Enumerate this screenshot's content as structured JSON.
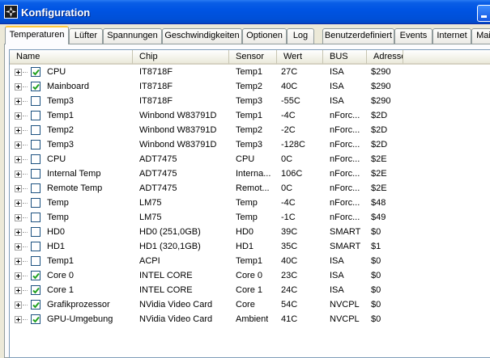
{
  "window": {
    "title": "Konfiguration"
  },
  "tabs": [
    {
      "label": "Temperaturen",
      "active": true
    },
    {
      "label": "Lüfter"
    },
    {
      "label": "Spannungen"
    },
    {
      "label": "Geschwindigkeiten"
    },
    {
      "label": "Optionen"
    },
    {
      "label": "Log"
    },
    {
      "label": "Benutzerdefiniert"
    },
    {
      "label": "Events"
    },
    {
      "label": "Internet"
    },
    {
      "label": "Mai"
    }
  ],
  "columns": [
    "Name",
    "Chip",
    "Sensor",
    "Wert",
    "BUS",
    "Adresse"
  ],
  "rows": [
    {
      "checked": true,
      "name": "CPU",
      "chip": "IT8718F",
      "sensor": "Temp1",
      "wert": "27C",
      "bus": "ISA",
      "adresse": "$290"
    },
    {
      "checked": true,
      "name": "Mainboard",
      "chip": "IT8718F",
      "sensor": "Temp2",
      "wert": "40C",
      "bus": "ISA",
      "adresse": "$290"
    },
    {
      "checked": false,
      "name": "Temp3",
      "chip": "IT8718F",
      "sensor": "Temp3",
      "wert": "-55C",
      "bus": "ISA",
      "adresse": "$290"
    },
    {
      "checked": false,
      "name": "Temp1",
      "chip": "Winbond W83791D",
      "sensor": "Temp1",
      "wert": "-4C",
      "bus": "nForc...",
      "adresse": "$2D"
    },
    {
      "checked": false,
      "name": "Temp2",
      "chip": "Winbond W83791D",
      "sensor": "Temp2",
      "wert": "-2C",
      "bus": "nForc...",
      "adresse": "$2D"
    },
    {
      "checked": false,
      "name": "Temp3",
      "chip": "Winbond W83791D",
      "sensor": "Temp3",
      "wert": "-128C",
      "bus": "nForc...",
      "adresse": "$2D"
    },
    {
      "checked": false,
      "name": "CPU",
      "chip": "ADT7475",
      "sensor": "CPU",
      "wert": "0C",
      "bus": "nForc...",
      "adresse": "$2E"
    },
    {
      "checked": false,
      "name": "Internal Temp",
      "chip": "ADT7475",
      "sensor": "Interna...",
      "wert": "106C",
      "bus": "nForc...",
      "adresse": "$2E"
    },
    {
      "checked": false,
      "name": "Remote Temp",
      "chip": "ADT7475",
      "sensor": "Remot...",
      "wert": "0C",
      "bus": "nForc...",
      "adresse": "$2E"
    },
    {
      "checked": false,
      "name": "Temp",
      "chip": "LM75",
      "sensor": "Temp",
      "wert": "-4C",
      "bus": "nForc...",
      "adresse": "$48"
    },
    {
      "checked": false,
      "name": "Temp",
      "chip": "LM75",
      "sensor": "Temp",
      "wert": "-1C",
      "bus": "nForc...",
      "adresse": "$49"
    },
    {
      "checked": false,
      "name": "HD0",
      "chip": "HD0 (251,0GB)",
      "sensor": "HD0",
      "wert": "39C",
      "bus": "SMART",
      "adresse": "$0"
    },
    {
      "checked": false,
      "name": "HD1",
      "chip": "HD1 (320,1GB)",
      "sensor": "HD1",
      "wert": "35C",
      "bus": "SMART",
      "adresse": "$1"
    },
    {
      "checked": false,
      "name": "Temp1",
      "chip": "ACPI",
      "sensor": "Temp1",
      "wert": "40C",
      "bus": "ISA",
      "adresse": "$0"
    },
    {
      "checked": true,
      "name": "Core 0",
      "chip": "INTEL CORE",
      "sensor": "Core 0",
      "wert": "23C",
      "bus": "ISA",
      "adresse": "$0"
    },
    {
      "checked": true,
      "name": "Core 1",
      "chip": "INTEL CORE",
      "sensor": "Core 1",
      "wert": "24C",
      "bus": "ISA",
      "adresse": "$0"
    },
    {
      "checked": true,
      "name": "Grafikprozessor",
      "chip": "NVidia Video Card",
      "sensor": "Core",
      "wert": "54C",
      "bus": "NVCPL",
      "adresse": "$0"
    },
    {
      "checked": true,
      "name": "GPU-Umgebung",
      "chip": "NVidia Video Card",
      "sensor": "Ambient",
      "wert": "41C",
      "bus": "NVCPL",
      "adresse": "$0"
    }
  ],
  "colors": {
    "titlebar": "#0054e3",
    "active_tab_highlight": "#ffc73c",
    "checkbox_border": "#1c5180",
    "checkmark": "#21a121"
  }
}
